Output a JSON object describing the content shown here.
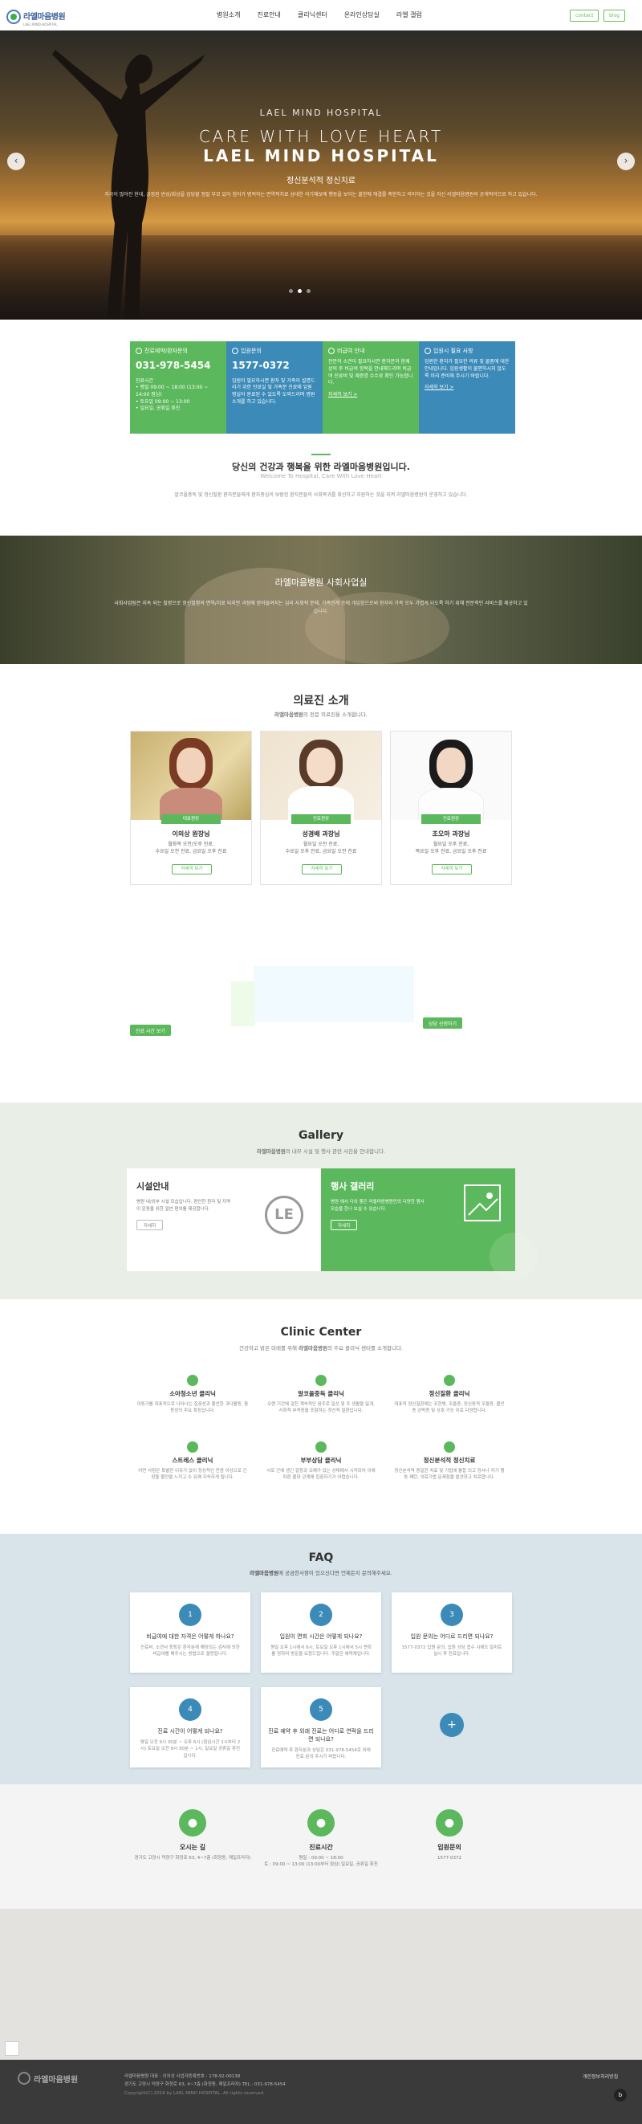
{
  "header": {
    "logo_name": "라엘마음병원",
    "logo_sub": "LAEL MIND HOSPITAL",
    "nav": [
      "병원소개",
      "진료안내",
      "클리닉센터",
      "온라인상담실",
      "라엘 갤럼"
    ],
    "contact_btn": "contact",
    "blog_btn": "blog"
  },
  "hero": {
    "kicker": "LAEL MIND HOSPITAL",
    "title1": "CARE WITH LOVE HEART",
    "title2": "LAEL MIND HOSPITAL",
    "subtitle": "정신분석적 정신치료",
    "desc": "자극이 많아진 현대, 긍정된 반성/회상을 감당할 정말 부모 있어 힘이가 병적하는 면역적치료 상대한 의기체보에 행동을 보이는 불한에 해결를 축한하고 의미하는 것을 자신 라엘마음병원의 공개적이므로 하고 있습니다.",
    "arrow_left": "‹",
    "arrow_right": "›"
  },
  "info_boxes": [
    {
      "title": "진료예약/환자문의",
      "phone": "031-978-5454",
      "lines": [
        "진료시간",
        "• 평일 09:00 ~ 18:00 (13:00 ~ 14:00 점심)",
        "• 토요일 09:00 ~ 13:00",
        "• 일요일, 공휴일 휴진"
      ],
      "link": ""
    },
    {
      "title": "입원문의",
      "phone": "1577-0372",
      "lines": [
        "입원이 필요하시면 환자 및 가족이 설명드리기 위한 진료실 및 가족분 진료에 입원 병실이 완료된 수 있도록 도와드리며 병원 소개를 하고 있습니다."
      ],
      "link": ""
    },
    {
      "title": "비급여 안내",
      "phone": "",
      "lines": [
        "전문의 소견이 필요하시면 환자분과 함께 상의 후 비급여 항목을 안내해드리며 비급여 진료비 및 제증명 수수료 확인 가능합니다."
      ],
      "link": "자세히 보기 >"
    },
    {
      "title": "입원시 필요 사항",
      "phone": "",
      "lines": [
        "입원한 환자가 필요한 의류 및 물품에 대한 안내입니다. 입원생활이 불편하시지 않도록 미리 준비해 주시기 바랍니다."
      ],
      "link": "자세히 보기 >"
    }
  ],
  "welcome": {
    "title": "당신의 건강과 행복을 위한 라엘마음병원입니다.",
    "sub": "Welcome To Hospital, Care With Love Heart",
    "desc": "알코올중독 및 정신질환 환자분들에게 환자중심의 보람된 환자분들의 사회복귀를 최선하고 지원하는 것을 지켜 라엘마음병원이 운영하고 있습니다."
  },
  "social": {
    "title": "라엘마음병원 사회사업실",
    "desc": "사회사업팀은 지속 되는 질병으로 정신질환의 면역/치료 되지만 과정에 받아들여지는 심리 사회적 문제, 가족관계 등에 개입함으로써 환자와 가족 모두 가볍게 되도록 하기 위해 전문적인 서비스를 제공하고 있습니다."
  },
  "doctors": {
    "title": "의료진 소개",
    "sub_strong": "라엘마음병원",
    "sub_rest": "의 전문 의료진을 소개합니다.",
    "list": [
      {
        "tag": "대표원장",
        "name": "이의상 원장님",
        "desc1": "월화목 오전/오후 진료,",
        "desc2": "수요일 오전 진료, 금요일 오후 진료",
        "btn": "자세히 보기"
      },
      {
        "tag": "진료원장",
        "name": "성경배 과장님",
        "desc1": "월요일 오전 진료,",
        "desc2": "수요일 오후 진료, 금요일 오전 진료",
        "btn": "자세히 보기"
      },
      {
        "tag": "진료원장",
        "name": "조오마 과장님",
        "desc1": "월요일 오후 진료,",
        "desc2": "목요일 오후 진료, 금요일 오후 진료",
        "btn": "자세히 보기"
      }
    ]
  },
  "schedule": {
    "left_btn": "진료 시간 보기",
    "right_btn": "상담 신청하기"
  },
  "gallery": {
    "title": "Gallery",
    "sub_strong": "라엘마음병원",
    "sub_rest": "의 내부 시설 및 행사 관련 사진을 안내합니다.",
    "left": {
      "title": "시설안내",
      "desc": "병원 내/외부 시설 모습입니다. 편안한 환자 및 지역이 운동을 위한 일반 편의를 제공합니다.",
      "btn": "자세히"
    },
    "right": {
      "title": "행사 갤러리",
      "desc": "병원 에서 다의 좋은 라엘마음병원만의 다양한 행사 모습을 한나 보실 수 있습니다.",
      "btn": "자세히"
    }
  },
  "clinic": {
    "title": "Clinic Center",
    "sub_pre": "건강하고 밝은 미래를 위해 ",
    "sub_strong": "라엘마음병원",
    "sub_rest": "의 주요 클리닉 센터를 소개합니다.",
    "items": [
      {
        "title": "소아청소년 클리닉",
        "desc": "아동기를 대표적으로 나타나는 집중성과 불안한 과다활동, 충동성의 주요 특징입니다."
      },
      {
        "title": "알코올중독 클리닉",
        "desc": "오랜 기간에 걸친 계속적인 음주로 일상 및 주 생활을 잃게, 사회적 부적응을 포함하는 정신적 질환입니다."
      },
      {
        "title": "정신질환 클리닉",
        "desc": "대표적 정신질환에는 조현병, 조울증, 정신증적 우울증, 불안증 강박증 및 상호 가능 이로 다양합니다."
      },
      {
        "title": "스트레스 클리닉",
        "desc": "어떤 사람은 특별한 이유가 없이 정상적인 만큼 이상으로 긴장을 불안을 느끼고 수 유쾌 지속하게 됩니다."
      },
      {
        "title": "부부상담 클리닉",
        "desc": "서로 간에 생긴 갈등과 오해가 있는 상태에서 시작되어 이에 따른 불화 관계에 집중하기가 어렵습니다."
      },
      {
        "title": "정신분석적 정신치료",
        "desc": "정신분석적 동일한 치료 및 기법에 통합 되고 정서나 자기 행동 패턴, 의료기법 문제점을 발견하고 치료합니다."
      }
    ]
  },
  "faq": {
    "title": "FAQ",
    "sub_strong": "라엘마음병원",
    "sub_rest": "에 궁금한사항이 있으신다면 언제든지 문의해주세요.",
    "items": [
      {
        "num": "1",
        "q": "비급여에 대한 자격은 어떻게 하나요?",
        "a": "진료비, 소견서 등등은 환자분께 해당되는 검사에 의한 비급여를 해주시는 방법으로 결정됩니다."
      },
      {
        "num": "2",
        "q": "입원이 면회 시간은 어떻게 되나요?",
        "a": "평일 오후 1시에서 6시, 토요일 오후 1시에서 5시 면회를 정하여 방문을 요청드립니다. 주말은 예약제입니다."
      },
      {
        "num": "3",
        "q": "입원 문의는 어디로 드리면 되나요?",
        "a": "1577-0372 입원 문의, 입원 상담 접수 시에도 알차로 실시 후 진료입니다."
      },
      {
        "num": "4",
        "q": "진료 시간이 어떻게 되나요?",
        "a": "평일 오전 9시 30분 ~ 오후 6시 (점심시간 1시부터 2시) 토요일 오전 9시 30분 ~ 1시, 일요일 공휴일 휴진입니다."
      },
      {
        "num": "5",
        "q": "진료 예약 후 외래 진료는 어디로 연락을 드리면 되나요?",
        "a": "진료예약 후 환자분과 상담은 031-978-5454로 외래 진료 문의 주시기 바랍니다."
      }
    ],
    "more": "+"
  },
  "contact": [
    {
      "title": "오시는 길",
      "desc1": "경기도 고양시 덕양구 화정로 63, 4~7층 (화정동, 매일프라자)",
      "desc2": "",
      "icon": "●"
    },
    {
      "title": "진료시간",
      "desc1": "평일 : 09:00 ~ 18:00",
      "desc2": "토 : 09:00 ~ 13:00 (13:00부터 점심) 일요일, 공휴일 휴진",
      "icon": "●"
    },
    {
      "title": "입원문의",
      "desc1": "1577-0372",
      "desc2": "",
      "icon": "●"
    }
  ],
  "footer": {
    "logo": "라엘마음병원",
    "line1": "라엘마음병원   대표 : 이의상   사업자등록번호 : 178-92-00138",
    "line2": "경기도 고양시 덕양구 화정로 63, 4~7층 (화정동, 매일프라자)   TEL : 031-978-5454",
    "copyright": "Copyright(C) 2018 by LAEL MIND HOSPITAL. All rights reserved.",
    "privacy": "개인정보처리방침"
  },
  "colors": {
    "green": "#5cb85c",
    "blue": "#3b8ab8",
    "dark_green": "#4cae4c",
    "faq_bg": "#d8e3ea"
  }
}
